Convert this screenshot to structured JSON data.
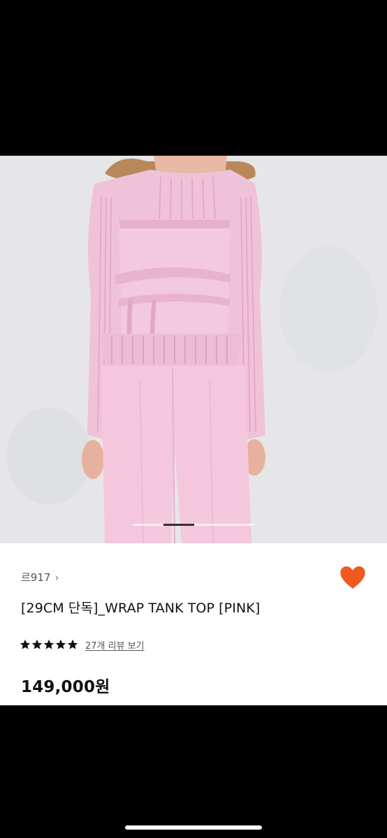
{
  "product": {
    "brand": "르917",
    "brand_chevron": "›",
    "title": "[29CM 단독]_WRAP TANK TOP [PINK]",
    "rating_stars": 5,
    "review_link": "27개 리뷰 보기",
    "price": "149,000원",
    "liked": true
  },
  "icons": {
    "like": "heart-icon",
    "star": "star-icon",
    "brand_chevron": "chevron-right-icon"
  },
  "colors": {
    "accent": "#f15a1f",
    "background_top": "#000000",
    "info_background": "#ffffff",
    "text_primary": "#111111",
    "text_secondary": "#555555",
    "garment_pink": "#f1c2d8"
  },
  "carousel": {
    "current_index": 2,
    "total": 4
  }
}
